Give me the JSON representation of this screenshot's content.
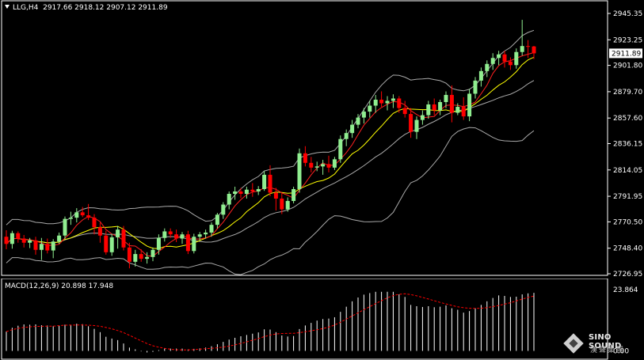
{
  "header": {
    "symbol_tf": "LLG,H4",
    "ohlc": "2917.66 2918.12 2907.12 2911.89"
  },
  "price_axis": {
    "ticks": [
      "2945.35",
      "2923.25",
      "2901.80",
      "2879.70",
      "2857.60",
      "2836.15",
      "2814.05",
      "2791.95",
      "2770.50",
      "2748.40",
      "2726.95"
    ],
    "current_price": "2911.89",
    "min": 2726.95,
    "max": 2945.35
  },
  "macd": {
    "label": "MACD(12,26,9) 20.898 17.948",
    "axis_top": "23.864",
    "axis_zero": "0.00"
  },
  "logo": {
    "brand": "SINO SOUND",
    "brand_sub": "漢聲集團"
  },
  "colors": {
    "bull": "#90ee90",
    "bear": "#ff0000",
    "bollinger": "#a9a9a9",
    "ma_fast": "#ff2020",
    "ma_slow": "#ffff00",
    "macd_hist": "#ffffff",
    "macd_signal": "#ff0000",
    "axis": "#ffffff",
    "background": "#000000"
  },
  "chart_data": {
    "type": "candlestick",
    "symbol": "LLG",
    "timeframe": "H4",
    "ylim": [
      2726.95,
      2945.35
    ],
    "candles": [
      [
        2758.0,
        2763.5,
        2747.5,
        2752.0
      ],
      [
        2752.0,
        2763.0,
        2748.0,
        2761.0
      ],
      [
        2761.0,
        2762.5,
        2753.0,
        2756.5
      ],
      [
        2756.5,
        2759.5,
        2749.0,
        2753.0
      ],
      [
        2753.0,
        2757.0,
        2748.5,
        2755.0
      ],
      [
        2755.0,
        2758.0,
        2743.0,
        2747.0
      ],
      [
        2747.0,
        2757.0,
        2738.5,
        2752.0
      ],
      [
        2752.0,
        2756.5,
        2744.0,
        2746.5
      ],
      [
        2746.5,
        2756.0,
        2740.0,
        2754.0
      ],
      [
        2754.0,
        2761.5,
        2752.0,
        2759.0
      ],
      [
        2759.0,
        2775.0,
        2756.0,
        2773.0
      ],
      [
        2773.0,
        2779.0,
        2768.0,
        2774.0
      ],
      [
        2774.0,
        2782.0,
        2770.0,
        2778.5
      ],
      [
        2778.5,
        2783.0,
        2774.5,
        2776.0
      ],
      [
        2776.0,
        2785.5,
        2772.0,
        2774.0
      ],
      [
        2774.0,
        2777.0,
        2760.0,
        2766.0
      ],
      [
        2766.0,
        2770.0,
        2753.0,
        2759.0
      ],
      [
        2759.0,
        2763.0,
        2743.0,
        2745.0
      ],
      [
        2745.0,
        2760.5,
        2742.0,
        2757.5
      ],
      [
        2757.5,
        2767.0,
        2748.0,
        2764.0
      ],
      [
        2764.0,
        2767.0,
        2746.5,
        2749.0
      ],
      [
        2749.0,
        2753.0,
        2731.5,
        2737.0
      ],
      [
        2737.0,
        2747.0,
        2733.0,
        2743.5
      ],
      [
        2743.5,
        2747.5,
        2737.0,
        2739.5
      ],
      [
        2739.5,
        2745.0,
        2735.5,
        2741.0
      ],
      [
        2741.0,
        2749.0,
        2737.5,
        2747.0
      ],
      [
        2747.0,
        2760.0,
        2743.0,
        2757.0
      ],
      [
        2757.0,
        2765.0,
        2754.0,
        2762.5
      ],
      [
        2762.5,
        2765.0,
        2757.0,
        2760.0
      ],
      [
        2760.0,
        2764.0,
        2753.5,
        2756.5
      ],
      [
        2756.5,
        2762.0,
        2752.0,
        2760.0
      ],
      [
        2760.0,
        2763.0,
        2743.5,
        2746.0
      ],
      [
        2746.0,
        2760.5,
        2744.0,
        2758.0
      ],
      [
        2758.0,
        2762.0,
        2755.0,
        2760.0
      ],
      [
        2760.0,
        2764.0,
        2756.5,
        2761.5
      ],
      [
        2761.5,
        2770.0,
        2758.0,
        2768.0
      ],
      [
        2768.0,
        2778.0,
        2765.0,
        2776.5
      ],
      [
        2776.5,
        2787.0,
        2773.0,
        2785.0
      ],
      [
        2785.0,
        2796.0,
        2781.0,
        2794.0
      ],
      [
        2794.0,
        2800.0,
        2789.0,
        2796.0
      ],
      [
        2796.0,
        2799.0,
        2790.5,
        2794.0
      ],
      [
        2794.0,
        2800.0,
        2790.0,
        2797.5
      ],
      [
        2797.5,
        2803.0,
        2791.5,
        2796.0
      ],
      [
        2796.0,
        2800.5,
        2793.0,
        2798.0
      ],
      [
        2798.0,
        2813.0,
        2796.5,
        2810.0
      ],
      [
        2810.0,
        2818.0,
        2792.0,
        2795.0
      ],
      [
        2795.0,
        2799.0,
        2780.0,
        2790.0
      ],
      [
        2790.0,
        2794.5,
        2777.0,
        2781.0
      ],
      [
        2781.0,
        2791.0,
        2779.0,
        2788.0
      ],
      [
        2788.0,
        2800.0,
        2786.0,
        2798.0
      ],
      [
        2798.0,
        2832.0,
        2795.0,
        2828.0
      ],
      [
        2828.0,
        2834.0,
        2817.0,
        2820.0
      ],
      [
        2820.0,
        2825.0,
        2812.0,
        2816.0
      ],
      [
        2816.0,
        2821.0,
        2813.0,
        2817.0
      ],
      [
        2817.0,
        2822.5,
        2810.0,
        2819.0
      ],
      [
        2819.0,
        2826.0,
        2812.0,
        2816.0
      ],
      [
        2816.0,
        2825.0,
        2814.0,
        2823.0
      ],
      [
        2823.0,
        2843.0,
        2820.0,
        2840.0
      ],
      [
        2840.0,
        2848.0,
        2834.0,
        2845.0
      ],
      [
        2845.0,
        2856.0,
        2841.0,
        2852.0
      ],
      [
        2852.0,
        2861.0,
        2849.0,
        2858.0
      ],
      [
        2858.0,
        2866.0,
        2853.0,
        2863.0
      ],
      [
        2863.0,
        2872.0,
        2858.0,
        2868.0
      ],
      [
        2868.0,
        2877.0,
        2862.0,
        2873.0
      ],
      [
        2873.0,
        2880.0,
        2867.0,
        2870.0
      ],
      [
        2870.0,
        2876.0,
        2864.0,
        2872.0
      ],
      [
        2872.0,
        2877.5,
        2866.0,
        2874.0
      ],
      [
        2874.0,
        2876.0,
        2862.0,
        2866.0
      ],
      [
        2866.0,
        2872.0,
        2858.0,
        2861.0
      ],
      [
        2861.0,
        2866.0,
        2841.0,
        2846.0
      ],
      [
        2846.0,
        2859.0,
        2840.0,
        2856.0
      ],
      [
        2856.0,
        2864.0,
        2852.0,
        2860.0
      ],
      [
        2860.0,
        2872.0,
        2857.0,
        2869.0
      ],
      [
        2869.0,
        2874.0,
        2860.0,
        2864.0
      ],
      [
        2864.0,
        2873.0,
        2860.0,
        2871.0
      ],
      [
        2871.0,
        2880.0,
        2866.0,
        2877.0
      ],
      [
        2877.0,
        2885.0,
        2854.0,
        2862.0
      ],
      [
        2862.0,
        2870.0,
        2860.0,
        2867.0
      ],
      [
        2867.0,
        2875.0,
        2856.0,
        2859.0
      ],
      [
        2859.0,
        2882.0,
        2855.0,
        2878.0
      ],
      [
        2878.0,
        2892.0,
        2874.0,
        2889.0
      ],
      [
        2889.0,
        2900.0,
        2884.0,
        2897.0
      ],
      [
        2897.0,
        2906.0,
        2892.0,
        2903.0
      ],
      [
        2903.0,
        2912.0,
        2898.0,
        2908.0
      ],
      [
        2908.0,
        2914.0,
        2902.0,
        2911.0
      ],
      [
        2911.0,
        2914.0,
        2900.0,
        2905.0
      ],
      [
        2905.0,
        2908.5,
        2898.0,
        2902.0
      ],
      [
        2902.0,
        2916.0,
        2899.0,
        2913.0
      ],
      [
        2913.0,
        2940.0,
        2910.0,
        2918.0
      ],
      [
        2918.0,
        2923.0,
        2908.0,
        2917.66
      ],
      [
        2917.66,
        2918.12,
        2907.12,
        2911.89
      ]
    ],
    "macd_histogram": [
      7.5,
      9.0,
      9.8,
      10.3,
      10.2,
      10.3,
      10.0,
      9.9,
      9.6,
      9.7,
      10.2,
      10.2,
      10.6,
      10.4,
      9.6,
      8.6,
      7.3,
      5.5,
      4.8,
      4.2,
      2.9,
      1.3,
      0.6,
      -0.2,
      -0.6,
      -0.4,
      0.3,
      1.0,
      0.9,
      0.9,
      0.9,
      0.6,
      0.8,
      1.0,
      1.3,
      1.8,
      2.6,
      3.5,
      4.4,
      5.1,
      5.7,
      6.2,
      6.7,
      7.2,
      8.4,
      8.3,
      7.3,
      6.0,
      5.6,
      5.8,
      8.5,
      9.9,
      10.9,
      11.8,
      12.4,
      12.6,
      13.1,
      15.2,
      17.2,
      19.3,
      20.8,
      21.9,
      22.5,
      23.0,
      23.0,
      23.0,
      23.0,
      22.0,
      21.0,
      17.9,
      17.4,
      17.1,
      17.4,
      17.0,
      17.2,
      17.7,
      16.6,
      16.0,
      14.9,
      15.5,
      16.6,
      17.9,
      19.3,
      20.6,
      21.6,
      21.4,
      21.0,
      21.1,
      22.0,
      22.4,
      22.6
    ],
    "macd_value": 20.898,
    "signal_value": 17.948,
    "macd_ylim": [
      -2.0,
      23.864
    ]
  }
}
